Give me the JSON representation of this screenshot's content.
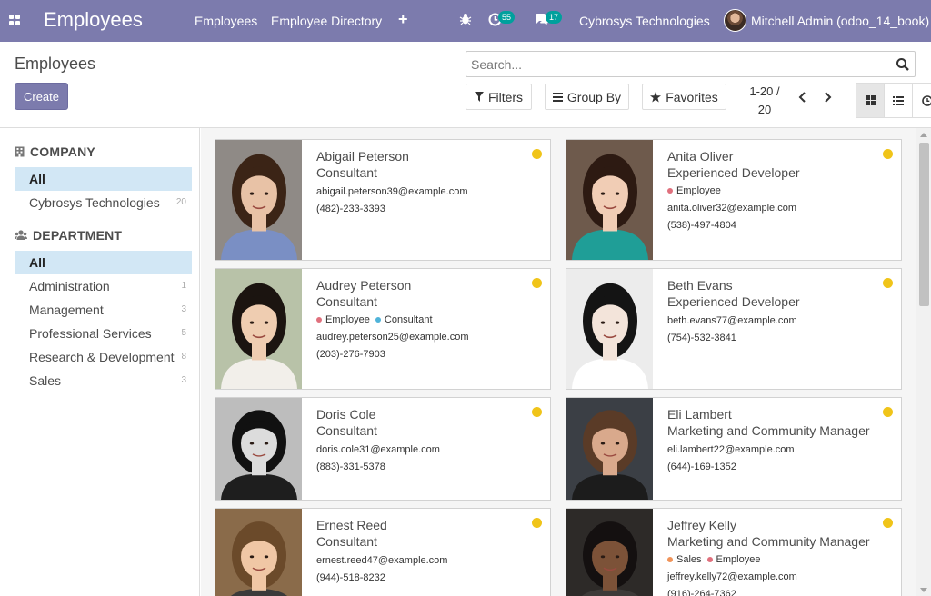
{
  "navbar": {
    "brand": "Employees",
    "menu": [
      "Employees",
      "Employee Directory"
    ],
    "activity_count": "55",
    "message_count": "17",
    "company": "Cybrosys Technologies",
    "user": "Mitchell Admin (odoo_14_book)",
    "background": "#7c7bad"
  },
  "control_panel": {
    "title": "Employees",
    "create_label": "Create",
    "search_placeholder": "Search...",
    "filters_label": "Filters",
    "groupby_label": "Group By",
    "favorites_label": "Favorites",
    "pager_range": "1-20 /",
    "pager_total": "20"
  },
  "sidebar": {
    "company": {
      "header": "COMPANY",
      "items": [
        {
          "label": "All",
          "count": ""
        },
        {
          "label": "Cybrosys Technologies",
          "count": "20"
        }
      ]
    },
    "department": {
      "header": "DEPARTMENT",
      "items": [
        {
          "label": "All",
          "count": ""
        },
        {
          "label": "Administration",
          "count": "1"
        },
        {
          "label": "Management",
          "count": "3"
        },
        {
          "label": "Professional Services",
          "count": "5"
        },
        {
          "label": "Research & Development",
          "count": "8"
        },
        {
          "label": "Sales",
          "count": "3"
        }
      ]
    }
  },
  "tag_colors": {
    "Employee": "#e0707d",
    "Consultant": "#4fb3d9",
    "Sales": "#f0945a"
  },
  "employees": [
    {
      "name": "Abigail Peterson",
      "job": "Consultant",
      "tags": [],
      "email": "abigail.peterson39@example.com",
      "phone": "(482)-233-3393",
      "photo": {
        "bg": "#8f8a86",
        "skin": "#e8c2a6",
        "hair": "#3b2416",
        "shirt": "#7a8fc4"
      }
    },
    {
      "name": "Anita Oliver",
      "job": "Experienced Developer",
      "tags": [
        "Employee"
      ],
      "email": "anita.oliver32@example.com",
      "phone": "(538)-497-4804",
      "photo": {
        "bg": "#6e5a4c",
        "skin": "#f1cdb5",
        "hair": "#2d1a12",
        "shirt": "#1f9e97"
      }
    },
    {
      "name": "Audrey Peterson",
      "job": "Consultant",
      "tags": [
        "Employee",
        "Consultant"
      ],
      "email": "audrey.peterson25@example.com",
      "phone": "(203)-276-7903",
      "photo": {
        "bg": "#b8c2a8",
        "skin": "#efcdb1",
        "hair": "#1b1410",
        "shirt": "#f2efea"
      }
    },
    {
      "name": "Beth Evans",
      "job": "Experienced Developer",
      "tags": [],
      "email": "beth.evans77@example.com",
      "phone": "(754)-532-3841",
      "photo": {
        "bg": "#ececec",
        "skin": "#f3e4da",
        "hair": "#141414",
        "shirt": "#ffffff"
      }
    },
    {
      "name": "Doris Cole",
      "job": "Consultant",
      "tags": [],
      "email": "doris.cole31@example.com",
      "phone": "(883)-331-5378",
      "photo": {
        "bg": "#bdbdbd",
        "skin": "#dcdcdc",
        "hair": "#111111",
        "shirt": "#1e1e1e"
      }
    },
    {
      "name": "Eli Lambert",
      "job": "Marketing and Community Manager",
      "tags": [],
      "email": "eli.lambert22@example.com",
      "phone": "(644)-169-1352",
      "photo": {
        "bg": "#3b3f45",
        "skin": "#d9a98c",
        "hair": "#5a3b27",
        "shirt": "#1c1c1c"
      }
    },
    {
      "name": "Ernest Reed",
      "job": "Consultant",
      "tags": [],
      "email": "ernest.reed47@example.com",
      "phone": "(944)-518-8232",
      "photo": {
        "bg": "#8a6b4a",
        "skin": "#f0c7a5",
        "hair": "#6b4a2a",
        "shirt": "#3a3a3a"
      }
    },
    {
      "name": "Jeffrey Kelly",
      "job": "Marketing and Community Manager",
      "tags": [
        "Sales",
        "Employee"
      ],
      "email": "jeffrey.kelly72@example.com",
      "phone": "(916)-264-7362",
      "photo": {
        "bg": "#2d2a28",
        "skin": "#7c5238",
        "hair": "#141010",
        "shirt": "#3d3a38"
      }
    }
  ]
}
